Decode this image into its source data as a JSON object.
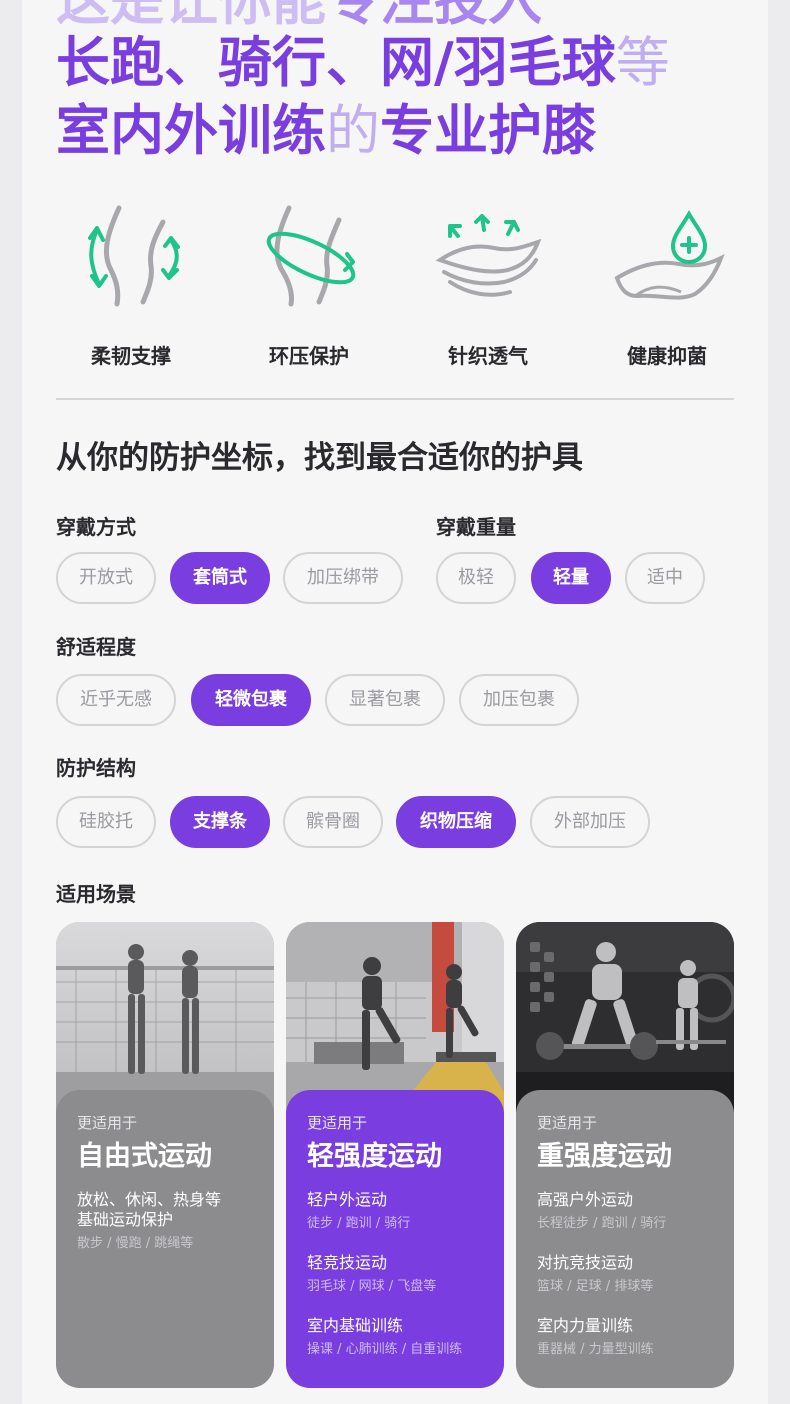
{
  "headline": {
    "line0_prefix": "这是让你能",
    "line0_strong": "专注投入",
    "line1_strong": "长跑、骑行、网/羽毛球",
    "line1_light": "等",
    "line2_strong": "室内外训练",
    "line2_light": "的",
    "line2_strong_b": "专业护膝"
  },
  "features": [
    {
      "icon": "flex-support-icon",
      "label": "柔韧支撑"
    },
    {
      "icon": "ring-compression-icon",
      "label": "环压保护"
    },
    {
      "icon": "knit-breathable-icon",
      "label": "针织透气"
    },
    {
      "icon": "antibacterial-icon",
      "label": "健康抑菌"
    }
  ],
  "section_title": "从你的防护坐标，找到最合适你的护具",
  "filters": {
    "wear_style": {
      "label": "穿戴方式",
      "options": [
        "开放式",
        "套筒式",
        "加压绑带"
      ],
      "selected": [
        "套筒式"
      ]
    },
    "wear_weight": {
      "label": "穿戴重量",
      "options": [
        "极轻",
        "轻量",
        "适中"
      ],
      "selected": [
        "轻量"
      ]
    },
    "comfort": {
      "label": "舒适程度",
      "options": [
        "近乎无感",
        "轻微包裹",
        "显著包裹",
        "加压包裹"
      ],
      "selected": [
        "轻微包裹"
      ]
    },
    "structure": {
      "label": "防护结构",
      "options": [
        "硅胶托",
        "支撑条",
        "髌骨圈",
        "织物压缩",
        "外部加压"
      ],
      "selected": [
        "支撑条",
        "织物压缩"
      ]
    },
    "scenes_label": "适用场景"
  },
  "scenes": [
    {
      "kicker": "更适用于",
      "title": "自由式运动",
      "desc_line1": "放松、休闲、热身等",
      "desc_line2": "基础运动保护",
      "sub": "散步 / 慢跑 / 跳绳等"
    },
    {
      "kicker": "更适用于",
      "title": "轻强度运动",
      "items": [
        {
          "name": "轻户外运动",
          "examples": "徒步 / 跑训 / 骑行"
        },
        {
          "name": "轻竞技运动",
          "examples": "羽毛球 / 网球 / 飞盘等"
        },
        {
          "name": "室内基础训练",
          "examples": "操课 / 心肺训练 / 自重训练"
        }
      ]
    },
    {
      "kicker": "更适用于",
      "title": "重强度运动",
      "items": [
        {
          "name": "高强户外运动",
          "examples": "长程徒步 / 跑训 / 骑行"
        },
        {
          "name": "对抗竞技运动",
          "examples": "篮球 / 足球 / 排球等"
        },
        {
          "name": "室内力量训练",
          "examples": "重器械 / 力量型训练"
        }
      ]
    }
  ],
  "colors": {
    "accent": "#7a3ee0",
    "chip_border": "#d4d4d8",
    "card_gray": "#8c8c8e"
  }
}
